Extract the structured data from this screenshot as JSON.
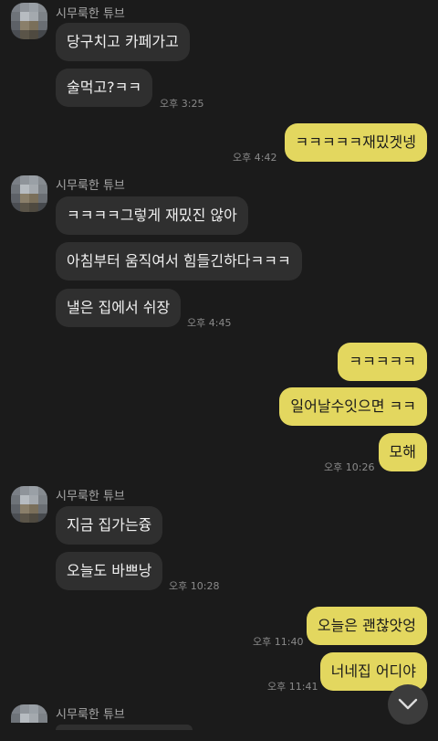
{
  "colors": {
    "background": "#1b1b1b",
    "incoming_bubble": "#2f2f2f",
    "outgoing_bubble": "#e3d75f",
    "timestamp": "#8a8a8a",
    "sender": "#a8a8a8"
  },
  "sender_name": "시무룩한 튜브",
  "messages": [
    {
      "dir": "in",
      "text": "당구치고 카페가고"
    },
    {
      "dir": "in",
      "text": "술먹고?ㅋㅋ",
      "time": "오후 3:25"
    },
    {
      "dir": "out",
      "text": "ㅋㅋㅋㅋㅋ재밌겟넹",
      "time": "오후 4:42"
    },
    {
      "dir": "in",
      "text": "ㅋㅋㅋㅋ그렇게 재밌진 않아"
    },
    {
      "dir": "in",
      "text": "아침부터 움직여서 힘들긴하다ㅋㅋㅋ"
    },
    {
      "dir": "in",
      "text": "낼은 집에서 쉬장",
      "time": "오후 4:45"
    },
    {
      "dir": "out",
      "text": "ㅋㅋㅋㅋㅋ"
    },
    {
      "dir": "out",
      "text": "일어날수잇으면 ㅋㅋ"
    },
    {
      "dir": "out",
      "text": "모해",
      "time": "오후 10:26"
    },
    {
      "dir": "in",
      "text": "지금 집가는즁"
    },
    {
      "dir": "in",
      "text": "오늘도 바쁘낭",
      "time": "오후 10:28"
    },
    {
      "dir": "out",
      "text": "오늘은 괜찮앗엉",
      "time": "오후 11:40"
    },
    {
      "dir": "out",
      "text": "너네집 어디야",
      "time": "오후 11:41"
    }
  ],
  "scroll_button": {
    "icon": "chevron-down-icon"
  }
}
